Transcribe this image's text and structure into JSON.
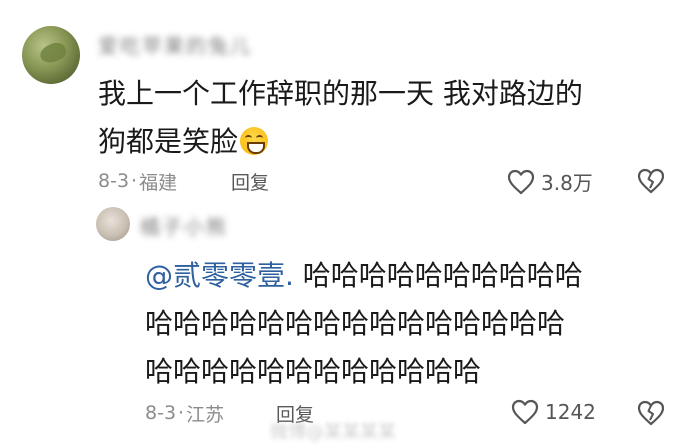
{
  "comment_1": {
    "username": "爱吃苹果的兔儿",
    "text_line_1": "我上一个工作辞职的那一天 我对路边的",
    "text_line_2": "狗都是笑脸",
    "emoji": "grinning-face-emoji",
    "date": "8-3",
    "separator": "·",
    "location": "福建",
    "reply_label": "回复",
    "like_count": "3.8万"
  },
  "comment_2": {
    "username": "橘子小熊",
    "mention": "@贰零零壹.",
    "text_line_1_rest": " 哈哈哈哈哈哈哈哈哈哈",
    "text_line_2": "哈哈哈哈哈哈哈哈哈哈哈哈哈哈哈",
    "text_line_3": "哈哈哈哈哈哈哈哈哈哈哈哈",
    "date": "8-3",
    "separator": "·",
    "location": "江苏",
    "reply_label": "回复",
    "like_count": "1242"
  },
  "watermark": "微博@某某某某"
}
